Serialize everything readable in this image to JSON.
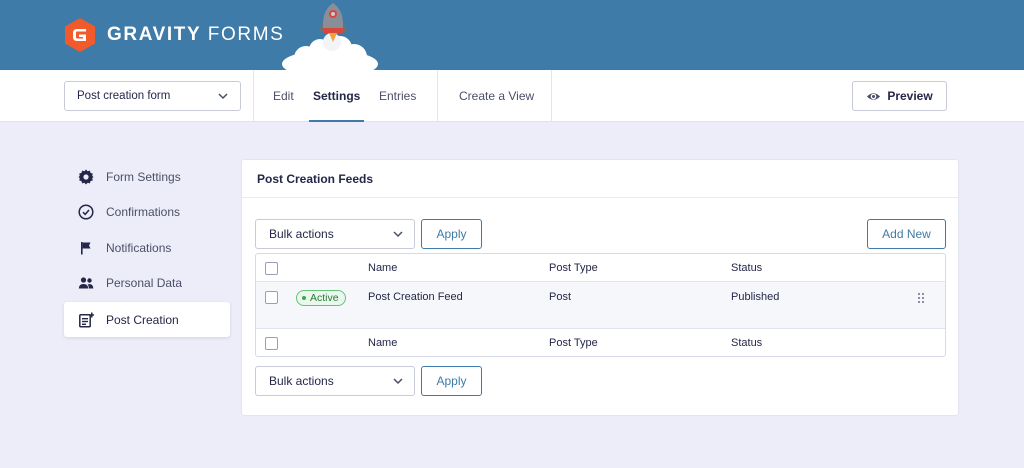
{
  "brand": {
    "name_bold": "GRAVITY",
    "name_light": "FORMS"
  },
  "nav": {
    "form_selector": "Post creation form",
    "tabs": [
      {
        "label": "Edit"
      },
      {
        "label": "Settings",
        "active": true
      },
      {
        "label": "Entries"
      },
      {
        "label": "Create a View"
      }
    ],
    "preview_label": "Preview"
  },
  "sidebar": {
    "items": [
      {
        "label": "Form Settings",
        "icon": "gear-icon"
      },
      {
        "label": "Confirmations",
        "icon": "check-circle-icon"
      },
      {
        "label": "Notifications",
        "icon": "flag-icon"
      },
      {
        "label": "Personal Data",
        "icon": "users-icon"
      },
      {
        "label": "Post Creation",
        "icon": "post-creation-icon",
        "active": true
      }
    ]
  },
  "panel": {
    "title": "Post Creation Feeds",
    "bulk_actions": "Bulk actions",
    "apply_label": "Apply",
    "add_new_label": "Add New",
    "columns": [
      "Name",
      "Post Type",
      "Status"
    ],
    "rows": [
      {
        "badge": "Active",
        "name": "Post Creation Feed",
        "post_type": "Post",
        "status": "Published"
      }
    ]
  },
  "colors": {
    "header_blue": "#3e7ba8",
    "background": "#ecedf8",
    "active_green": "#38a852",
    "logo_orange": "#f15a2b"
  }
}
